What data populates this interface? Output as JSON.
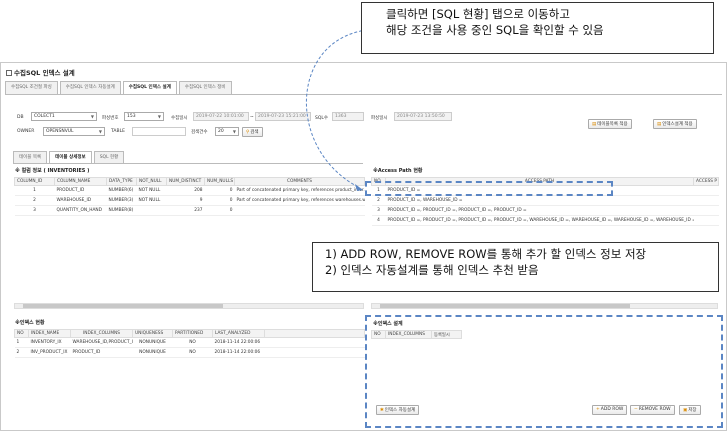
{
  "callouts": {
    "top_line1": "클릭하면 [SQL 현황] 탭으로 이동하고",
    "top_line2": "해당 조건을 사용 중인 SQL을 확인할 수 있음",
    "mid_line1": "1) ADD ROW, REMOVE ROW를 통해  추가 할 인덱스 정보 저장",
    "mid_line2": "2) 인덱스 자동설계를 통해 인덱스 추천 받음"
  },
  "app": {
    "title": "수집SQL 인덱스 설계",
    "tabs": [
      "수집SQL 조건절 파싱",
      "수집SQL 인덱스 자동설계",
      "수집SQL 인덱스 설계",
      "수집SQL 인덱스 정비"
    ],
    "active_tab": 2
  },
  "filters": {
    "db_label": "DB",
    "db_value": "COLECT1",
    "parse_no_label": "파싱번호",
    "parse_no_value": "153",
    "collect_date_label": "수집일시",
    "collect_from": "2019-07-22 10:01:00",
    "tilde": "~",
    "collect_to": "2019-07-23 15:21:00",
    "sql_count_label": "SQL수",
    "sql_count_value": "1363",
    "parse_date_label": "파싱일시",
    "parse_date_value": "2019-07-23 13:50:50",
    "owner_label": "OWNER",
    "owner_value": "OPENSNVUL",
    "table_label": "TABLE",
    "table_value": "",
    "search_count_label": "검색건수",
    "search_count_value": "20",
    "search_button": "검색",
    "table_list_button": "테이블목록 적용",
    "index_design_button": "인덱스설계 적용"
  },
  "sub_tabs": [
    "테이블 목록",
    "테이블 상세정보",
    "SQL 현황"
  ],
  "column_info": {
    "title": "※ 컬럼 정보 ( INVENTORIES )",
    "headers": [
      "COLUMN_ID",
      "COLUMN_NAME",
      "DATA_TYPE",
      "NOT_NULL",
      "NUM_DISTINCT",
      "NUM_NULLS",
      "COMMENTS"
    ],
    "rows": [
      [
        "1",
        "PRODUCT_ID",
        "NUMBER(6)",
        "NOT NULL",
        "208",
        "0",
        "Part of concatenated primary key, references product_infor..."
      ],
      [
        "2",
        "WAREHOUSE_ID",
        "NUMBER(3)",
        "NOT NULL",
        "9",
        "0",
        "Part of concatenated primary key, references warehouses.w..."
      ],
      [
        "3",
        "QUANTITY_ON_HAND",
        "NUMBER(8)",
        "",
        "237",
        "0",
        ""
      ]
    ]
  },
  "index_status": {
    "title": "※인덱스 현황",
    "headers": [
      "NO",
      "INDEX_NAME",
      "INDEX_COLUMNS",
      "UNIQUENESS",
      "PARTITIONED",
      "LAST_ANALYZED"
    ],
    "rows": [
      [
        "1",
        "INVENTORY_IX",
        "WAREHOUSE_ID,PRODUCT_ID",
        "NONUNIQUE",
        "NO",
        "2018-11-14 22:00:06"
      ],
      [
        "2",
        "INV_PRODUCT_IX",
        "PRODUCT_ID",
        "NONUNIQUE",
        "NO",
        "2018-11-14 22:00:06"
      ]
    ]
  },
  "access_path": {
    "title": "※Access Path 현황",
    "headers": [
      "NO",
      "ACCESS PATH",
      "ACCESS P"
    ],
    "rows": [
      [
        "1",
        "PRODUCT_ID ="
      ],
      [
        "2",
        "PRODUCT_ID =, WAREHOUSE_ID ="
      ],
      [
        "3",
        "PRODUCT_ID =, PRODUCT_ID =, PRODUCT_ID =, PRODUCT_ID ="
      ],
      [
        "4",
        "PRODUCT_ID =, PRODUCT_ID =, PRODUCT_ID =, PRODUCT_ID =, WAREHOUSE_ID =, WAREHOUSE_ID =, WAREHOUSE_ID =, WAREHOUSE_ID ="
      ]
    ]
  },
  "index_design": {
    "title": "※인덱스 설계",
    "headers": [
      "NO",
      "INDEX_COLUMNS",
      "등록일시"
    ],
    "auto_button": "인덱스 자동설계",
    "add_row": "ADD ROW",
    "remove_row": "REMOVE ROW",
    "save": "저장"
  }
}
